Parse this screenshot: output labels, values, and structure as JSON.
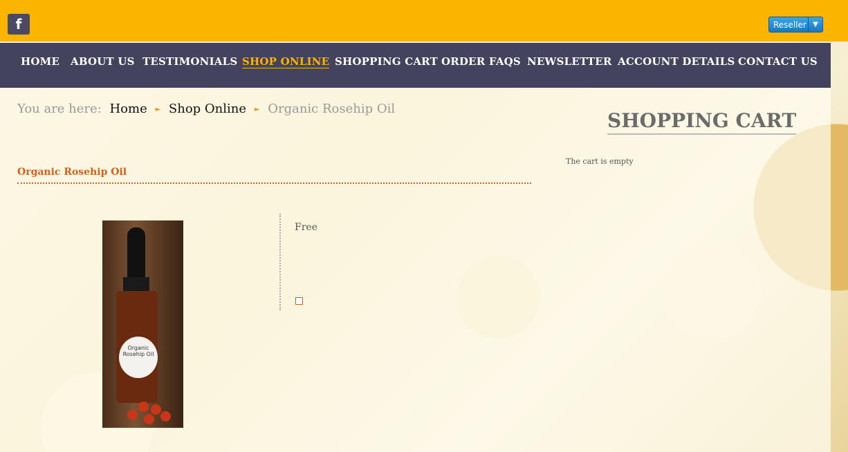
{
  "header": {
    "social_icon": "f",
    "reseller_label": "Reseller"
  },
  "nav": {
    "items": [
      {
        "label": "HOME"
      },
      {
        "label": "ABOUT US"
      },
      {
        "label": "TESTIMONIALS"
      },
      {
        "label": "SHOP ONLINE",
        "active": true
      },
      {
        "label": "SHOPPING CART"
      },
      {
        "label": "ORDER FAQS"
      },
      {
        "label": "NEWSLETTER"
      },
      {
        "label": "ACCOUNT DETAILS"
      },
      {
        "label": "CONTACT US"
      }
    ]
  },
  "breadcrumb": {
    "prefix": "You are here:",
    "items": [
      "Home",
      "Shop Online",
      "Organic Rosehip Oil"
    ]
  },
  "product": {
    "title": "Organic Rosehip Oil",
    "price": "Free",
    "image_label_line1": "Organic",
    "image_label_line2": "Rosehip Oil"
  },
  "sidebar": {
    "cart_heading": "SHOPPING CART",
    "cart_empty_text": "The cart is empty"
  },
  "colors": {
    "topbar": "#fbb400",
    "navbar": "#44435e",
    "accent": "#d0621c"
  }
}
